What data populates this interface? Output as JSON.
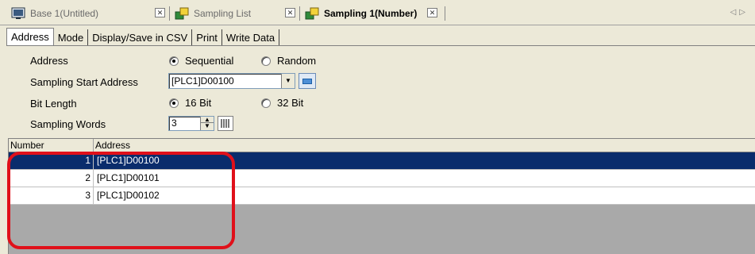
{
  "doc_tabs": [
    {
      "label": "Base 1(Untitled)",
      "active": false
    },
    {
      "label": "Sampling List",
      "active": false
    },
    {
      "label": "Sampling 1(Number)",
      "active": true
    }
  ],
  "page_tabs": [
    "Address",
    "Mode",
    "Display/Save in CSV",
    "Print",
    "Write Data"
  ],
  "form": {
    "address_label": "Address",
    "address_options": [
      {
        "label": "Sequential",
        "selected": true
      },
      {
        "label": "Random",
        "selected": false
      }
    ],
    "start_address_label": "Sampling Start Address",
    "start_address_value": "[PLC1]D00100",
    "bit_length_label": "Bit Length",
    "bit_length_options": [
      {
        "label": "16 Bit",
        "selected": true
      },
      {
        "label": "32 Bit",
        "selected": false
      }
    ],
    "sampling_words_label": "Sampling Words",
    "sampling_words_value": "3"
  },
  "table": {
    "columns": [
      "Number",
      "Address"
    ],
    "rows": [
      {
        "number": "1",
        "address": "[PLC1]D00100",
        "selected": true
      },
      {
        "number": "2",
        "address": "[PLC1]D00101",
        "selected": false
      },
      {
        "number": "3",
        "address": "[PLC1]D00102",
        "selected": false
      }
    ]
  },
  "colors": {
    "selection": "#0a2c6c",
    "highlight": "#e0101a",
    "window_bg": "#ece9d8"
  }
}
